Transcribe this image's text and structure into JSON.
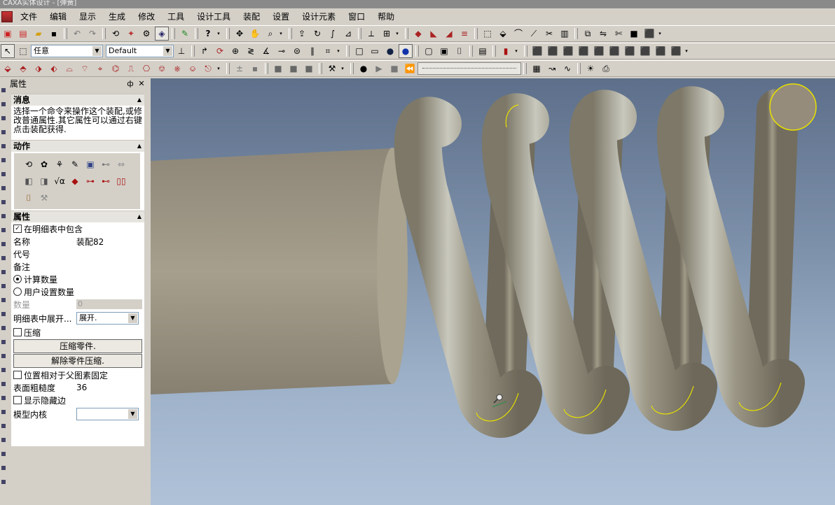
{
  "window": {
    "title": "CAXA实体设计 - [弹簧]"
  },
  "menu": [
    "文件",
    "编辑",
    "显示",
    "生成",
    "修改",
    "工具",
    "设计工具",
    "装配",
    "设置",
    "设计元素",
    "窗口",
    "帮助"
  ],
  "toolbar2": {
    "select_mode": "任意",
    "style": "Default"
  },
  "panel": {
    "title": "属性",
    "pin_label": "ф",
    "close_label": "✕",
    "message_header": "消息",
    "message_text": "选择一个命令来操作这个装配,或修改普通属性.其它属性可以通过右键点击装配获得.",
    "actions_header": "动作",
    "properties_header": "属性",
    "include_in_bom": "在明细表中包含",
    "name_label": "名称",
    "name_value": "装配82",
    "code_label": "代号",
    "note_label": "备注",
    "calc_qty": "计算数量",
    "user_qty": "用户设置数量",
    "qty_label": "数量",
    "qty_value": "0",
    "expand_label": "明细表中展开...",
    "expand_value": "展开.",
    "compress_label": "压缩",
    "compress_btn": "压缩零件.",
    "uncompress_btn": "解除零件压缩.",
    "fix_pos": "位置相对于父图素固定",
    "roughness_label": "表面粗糙度",
    "roughness_value": "36",
    "show_hidden": "显示隐藏边",
    "kernel_label": "模型内核",
    "kernel_value": ""
  },
  "colors": {
    "accent": "#d4d0c8",
    "viewport_top": "#5d6f8a",
    "viewport_bottom": "#b0c2d8",
    "highlight": "#e8e000"
  }
}
